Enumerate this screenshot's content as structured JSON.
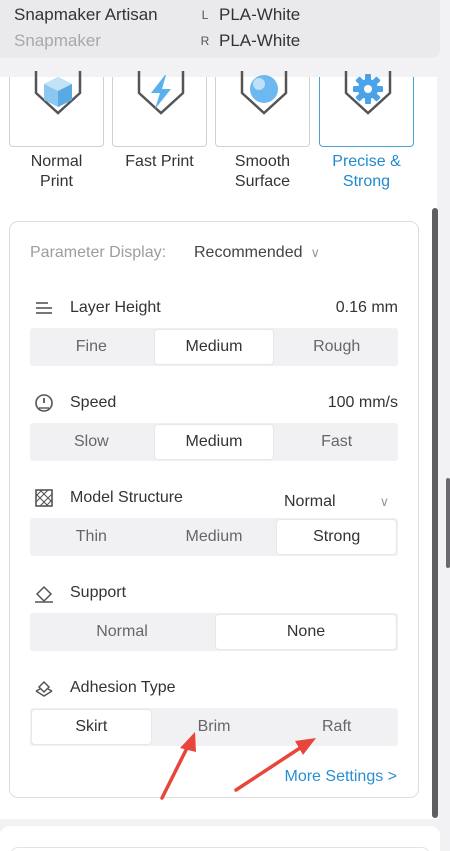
{
  "machine": {
    "name": "Snapmaker Artisan",
    "brand": "Snapmaker",
    "nozzle_left_badge": "L",
    "nozzle_left_material": "PLA-White",
    "nozzle_right_badge": "R",
    "nozzle_right_material": "PLA-White"
  },
  "presets": [
    {
      "label": "Normal Print",
      "icon": "cube-icon",
      "active": false
    },
    {
      "label": "Fast Print",
      "icon": "lightning-icon",
      "active": false
    },
    {
      "label": "Smooth Surface",
      "icon": "sphere-icon",
      "active": false
    },
    {
      "label": "Precise & Strong",
      "icon": "gear-icon",
      "active": true
    }
  ],
  "parameter_display": {
    "label": "Parameter Display:",
    "value": "Recommended"
  },
  "layer_height": {
    "title": "Layer Height",
    "value": "0.16 mm",
    "options": [
      "Fine",
      "Medium",
      "Rough"
    ],
    "selected": "Medium"
  },
  "speed": {
    "title": "Speed",
    "value": "100 mm/s",
    "options": [
      "Slow",
      "Medium",
      "Fast"
    ],
    "selected": "Medium"
  },
  "model_structure": {
    "title": "Model Structure",
    "value": "Normal",
    "options": [
      "Thin",
      "Medium",
      "Strong"
    ],
    "selected": "Strong"
  },
  "support": {
    "title": "Support",
    "options": [
      "Normal",
      "None"
    ],
    "selected": "None"
  },
  "adhesion": {
    "title": "Adhesion Type",
    "options": [
      "Skirt",
      "Brim",
      "Raft"
    ],
    "selected": "Skirt"
  },
  "more_settings": "More Settings >",
  "colors": {
    "accent": "#1f8ad0",
    "annotation_arrow": "#e8463a",
    "icon_blue": "#4aa8e8"
  }
}
